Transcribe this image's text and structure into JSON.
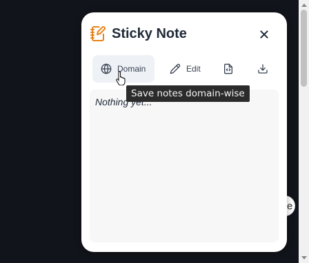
{
  "popup": {
    "title": "Sticky Note",
    "toolbar": {
      "domain_label": "Domain",
      "edit_label": "Edit"
    },
    "note": {
      "content": "Nothing yet..."
    },
    "tooltip": "Save notes domain-wise"
  },
  "icons": {
    "logo": "notebook-pen-icon",
    "close": "close-icon",
    "domain": "globe-icon",
    "edit": "pencil-icon",
    "file": "file-code-icon",
    "download": "download-icon",
    "cursor": "hand-pointer-icon"
  },
  "colors": {
    "accent": "#e8821a",
    "page_background": "#12141b",
    "card_background": "#ffffff",
    "active_button": "#eef1f5",
    "note_background": "#f7f7f8",
    "tooltip_background": "#2b2b2b"
  }
}
